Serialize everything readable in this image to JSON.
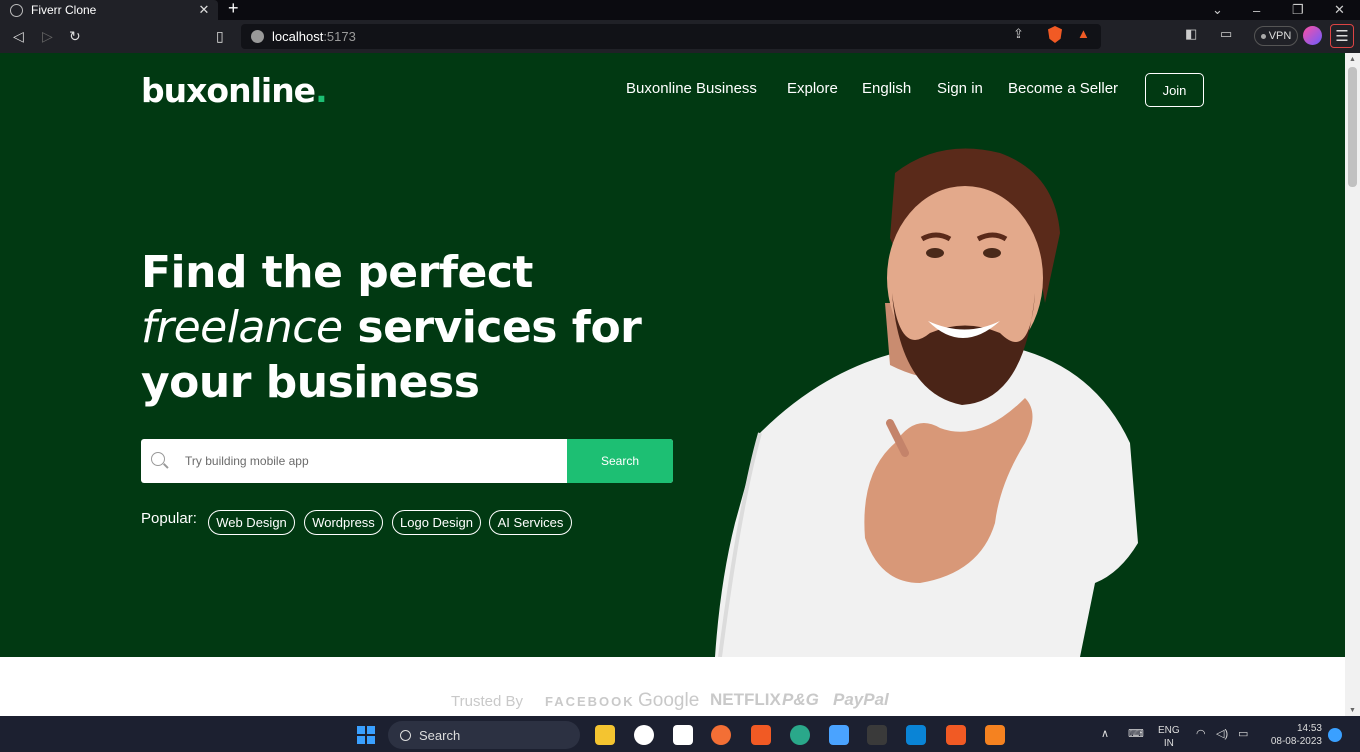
{
  "browser": {
    "tab_title": "Fiverr Clone",
    "tab_close": "✕",
    "new_tab": "+",
    "url_host": "localhost",
    "url_port": ":5173",
    "vpn_label": "VPN"
  },
  "header": {
    "logo_text": "buxonline",
    "logo_dot": ".",
    "nav": [
      "Buxonline Business",
      "Explore",
      "English",
      "Sign in",
      "Become a Seller"
    ],
    "join_label": "Join"
  },
  "hero": {
    "headline_line1": "Find the perfect",
    "headline_italic": "freelance",
    "headline_line2_rest": " services for",
    "headline_line3": "your business",
    "search_placeholder": "Try building mobile app",
    "search_button": "Search",
    "popular_label": "Popular:",
    "popular_tags": [
      "Web Design",
      "Wordpress",
      "Logo Design",
      "AI Services"
    ]
  },
  "trusted": {
    "label": "Trusted By",
    "brands": [
      "FACEBOOK",
      "Google",
      "NETFLIX",
      "P&G",
      "PayPal"
    ]
  },
  "taskbar": {
    "search_label": "Search",
    "lang_line1": "ENG",
    "lang_line2": "IN",
    "time": "14:53",
    "date": "08-08-2023"
  },
  "colors": {
    "hero_bg": "#013912",
    "accent": "#1dbf73"
  }
}
